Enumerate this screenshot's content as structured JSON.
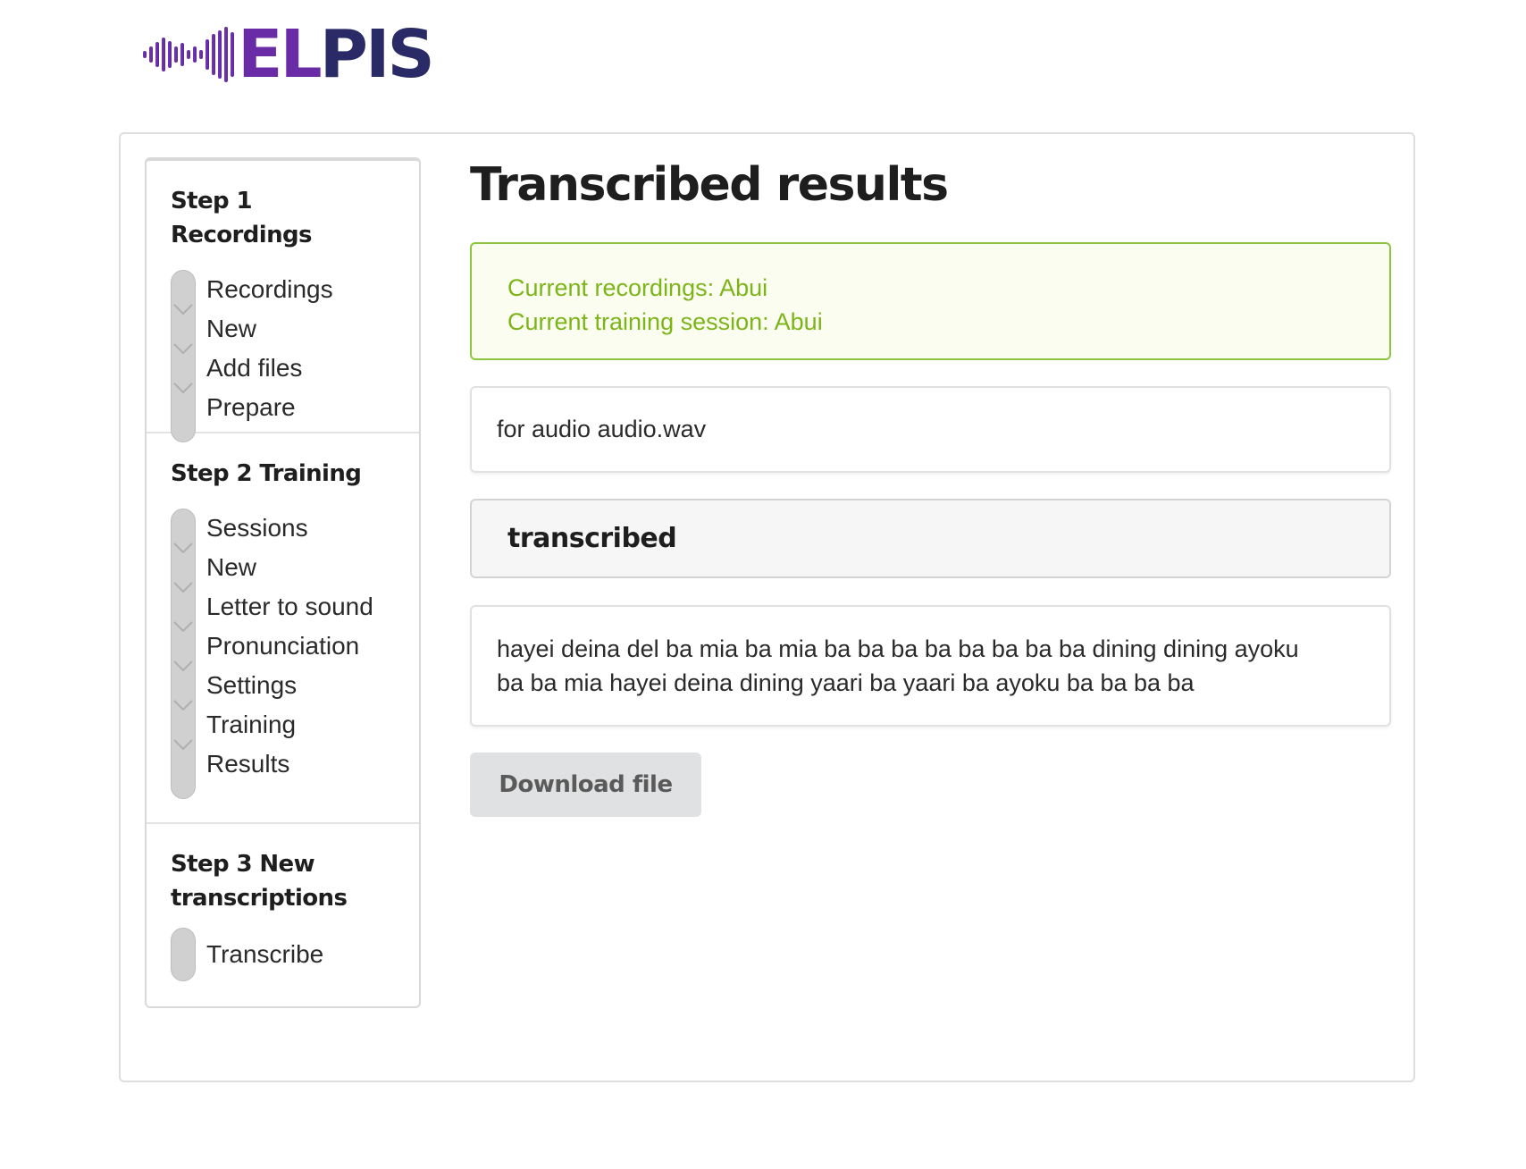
{
  "brand": {
    "logo_text_el": "EL",
    "logo_text_pis": "PIS",
    "colors": {
      "purple": "#6a2ba6",
      "navy": "#2a2a66"
    }
  },
  "sidebar": {
    "sections": [
      {
        "title": "Step 1 Recordings",
        "items": [
          "Recordings",
          "New",
          "Add files",
          "Prepare"
        ]
      },
      {
        "title": "Step 2 Training",
        "items": [
          "Sessions",
          "New",
          "Letter to sound",
          "Pronunciation",
          "Settings",
          "Training",
          "Results"
        ]
      },
      {
        "title_line1": "Step 3 New",
        "title_line2": "transcriptions",
        "items": [
          "Transcribe"
        ]
      }
    ]
  },
  "main": {
    "title": "Transcribed results",
    "status": {
      "recordings": "Current recordings: Abui",
      "session": "Current training session: Abui",
      "color": "#7cb518"
    },
    "file_label": "for audio audio.wav",
    "section_header": "transcribed",
    "transcript_line1": "hayei deina del ba mia ba mia ba ba ba ba ba ba ba ba dining dining ayoku",
    "transcript_line2": "ba ba mia hayei deina dining yaari ba yaari ba ayoku ba ba ba ba",
    "download_label": "Download file"
  }
}
